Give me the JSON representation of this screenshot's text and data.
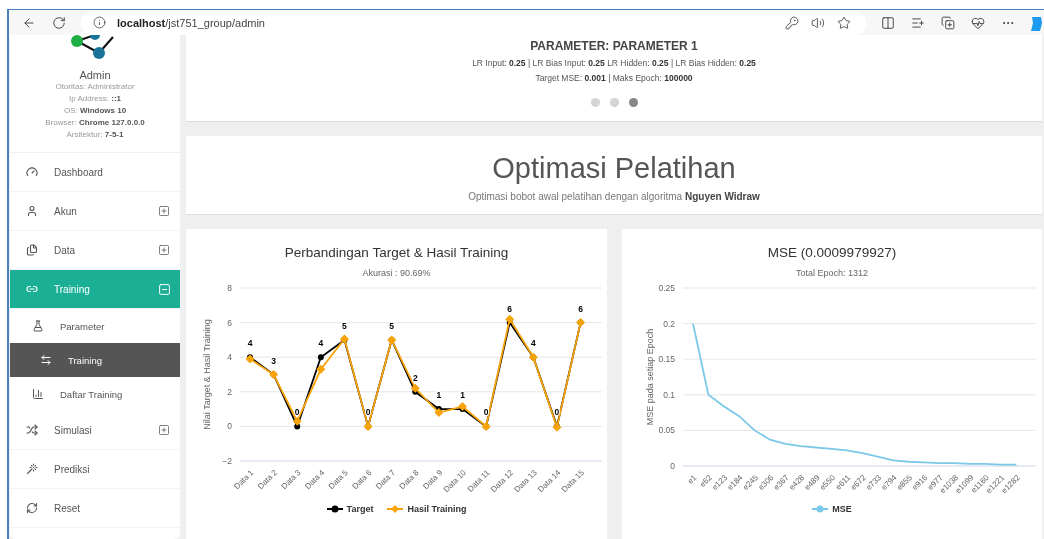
{
  "browser": {
    "url_host": "localhost",
    "url_path": "/jst751_group/admin"
  },
  "sidebar": {
    "user": {
      "name": "Admin",
      "lines": [
        "Otoritas: Administrator",
        "Ip Address: **::1**",
        "OS: **Windows 10**",
        "Browser: **Chrome 127.0.0.0**",
        "Arsitektur: **7-5-1**"
      ]
    },
    "menu": [
      {
        "label": "Dashboard",
        "selected": false
      },
      {
        "label": "Akun",
        "expandable": true,
        "expanded": false,
        "selected": false
      },
      {
        "label": "Data",
        "expandable": true,
        "expanded": false,
        "selected": false
      },
      {
        "label": "Training",
        "expandable": true,
        "expanded": true,
        "selected": true,
        "children": [
          {
            "label": "Parameter",
            "selected": false
          },
          {
            "label": "Training",
            "selected": true
          },
          {
            "label": "Daftar Training",
            "selected": false
          }
        ]
      },
      {
        "label": "Simulasi",
        "expandable": true,
        "expanded": false,
        "selected": false
      },
      {
        "label": "Prediksi",
        "selected": false
      },
      {
        "label": "Reset",
        "selected": false
      }
    ]
  },
  "parameter_card": {
    "title": "PARAMETER: PARAMETER 1",
    "lines": [
      "LR Input: **0.25** | LR Bias Input: **0.25** LR Hidden: **0.25** | LR Bias Hidden: **0.25**",
      "Target MSE: **0.001** | Maks Epoch: **100000**"
    ],
    "dots": [
      {
        "selected": false
      },
      {
        "selected": false
      },
      {
        "selected": true
      }
    ]
  },
  "header_card": {
    "title": "Optimasi Pelatihan",
    "subtitle": "Optimasi bobot awal pelatihan dengan algoritma **Nguyen Widraw**"
  },
  "charts": [
    {
      "subtitle": "Akurasi : 90.69%",
      "chart_data": {
        "type": "line",
        "title": "Perbandingan Target & Hasil Training",
        "ylabel": "Nilai Target & Hasil Training",
        "categories": [
          "Data 1",
          "Data 2",
          "Data 3",
          "Data 4",
          "Data 5",
          "Data 6",
          "Data 7",
          "Data 8",
          "Data 9",
          "Data 10",
          "Data 11",
          "Data 12",
          "Data 13",
          "Data 14",
          "Data 15"
        ],
        "ylim": [
          -2,
          8
        ],
        "yticks": [
          {
            "value": -2,
            "label": "−2"
          },
          0,
          2,
          4,
          6,
          8
        ],
        "grid": true,
        "series": [
          {
            "name": "Target",
            "color": "#000000",
            "marker": "circle",
            "values": [
              4,
              3,
              0,
              4,
              5,
              0,
              5,
              2,
              1,
              1,
              0,
              6,
              4,
              0,
              6
            ],
            "value_labels": [
              "4",
              "3",
              "0",
              "4",
              "5",
              "0",
              "5",
              "2",
              "1",
              "1",
              "0",
              "6",
              "4",
              "0",
              "6"
            ]
          },
          {
            "name": "Hasil Training",
            "color": "#f7a30a",
            "marker": "diamond",
            "values": [
              3.9,
              3,
              0.3,
              3.3,
              5.05,
              0,
              5,
              2.2,
              0.8,
              1.15,
              0,
              6.2,
              4,
              -0.05,
              6
            ]
          }
        ]
      }
    },
    {
      "subtitle": "Total Epoch: 1312",
      "chart_data": {
        "type": "line",
        "title": "MSE (0.0009979927)",
        "ylabel": "MSE pada setiap Epoch",
        "categories": [
          "e1",
          "e62",
          "e123",
          "e184",
          "e245",
          "e306",
          "e367",
          "e428",
          "e489",
          "e550",
          "e611",
          "e672",
          "e733",
          "e794",
          "e855",
          "e916",
          "e977",
          "e1038",
          "e1099",
          "e1160",
          "e1221",
          "e1282"
        ],
        "ylim": [
          0,
          0.25
        ],
        "yticks": [
          0,
          0.05,
          0.1,
          0.15,
          0.2,
          0.25
        ],
        "grid": true,
        "series": [
          {
            "name": "MSE",
            "color": "#7cc8e8",
            "marker": "none",
            "values": [
              0.2,
              0.1,
              0.084,
              0.07,
              0.05,
              0.037,
              0.031,
              0.028,
              0.026,
              0.024,
              0.022,
              0.018,
              0.013,
              0.008,
              0.006,
              0.005,
              0.004,
              0.004,
              0.003,
              0.003,
              0.002,
              0.002
            ]
          }
        ]
      }
    }
  ]
}
